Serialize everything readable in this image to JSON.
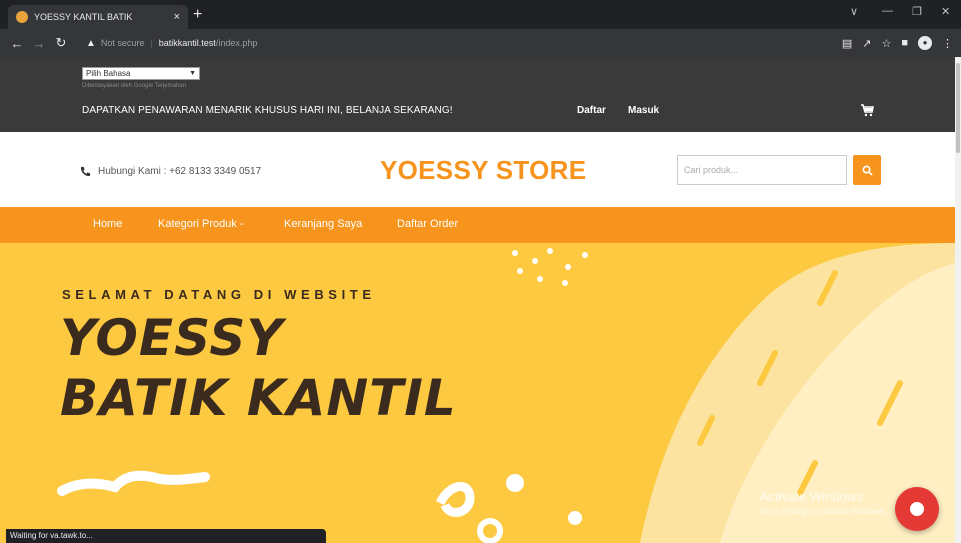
{
  "browser": {
    "tab_title": "YOESSY KANTIL BATIK",
    "tab_close": "×",
    "new_tab": "+",
    "security_label": "Not secure",
    "url_host": "batikkantil.test",
    "url_path": "/index.php",
    "status_text": "Waiting for va.tawk.to..."
  },
  "topbar": {
    "language_select": "Pilih Bahasa",
    "translate_note": "Diberdayakan oleh Google Terjemahan",
    "promo_text": "DAPATKAN PENAWARAN MENARIK KHUSUS HARI INI, BELANJA SEKARANG!",
    "register_link": "Daftar",
    "login_link": "Masuk"
  },
  "header": {
    "phone_text": "Hubungi Kami : +62 8133 3349 0517",
    "store_name": "YOESSY STORE",
    "search_placeholder": "Cari produk..."
  },
  "nav": {
    "items": [
      "Home",
      "Kategori Produk -",
      "Keranjang Saya",
      "Daftar Order"
    ]
  },
  "hero": {
    "welcome": "SELAMAT DATANG DI WEBSITE",
    "line1": "YOESSY",
    "line2": "BATIK KANTIL"
  },
  "overlay": {
    "activate_title": "Activate Windows",
    "activate_sub": "Go to Settings to activate Windows."
  },
  "colors": {
    "accent": "#f7941d",
    "topbar": "#3a3a3a",
    "hero_bg": "#fcc940",
    "hero_text": "#3b2a1e"
  }
}
